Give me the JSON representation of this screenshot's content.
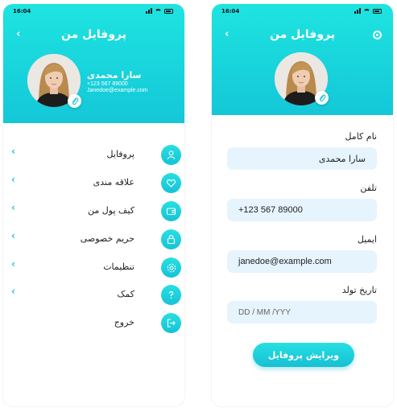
{
  "status_bar": {
    "time": "16:04"
  },
  "left_screen": {
    "title": "پروفایل من",
    "back_glyph": "‹",
    "user": {
      "name": "سارا محمدی",
      "phone": "+123 567 89000",
      "email": "Janedoe@example.com"
    },
    "menu": [
      {
        "label": "پروفایل",
        "icon": "user-icon"
      },
      {
        "label": "علاقه مندی",
        "icon": "heart-icon"
      },
      {
        "label": "کیف پول من",
        "icon": "wallet-icon"
      },
      {
        "label": "حریم خصوصی",
        "icon": "lock-icon"
      },
      {
        "label": "تنظیمات",
        "icon": "gear-icon"
      },
      {
        "label": "کمک",
        "icon": "help-icon"
      },
      {
        "label": "خروج",
        "icon": "logout-icon"
      }
    ]
  },
  "right_screen": {
    "title": "پروفایل من",
    "back_glyph": "‹",
    "fields": {
      "full_name": {
        "label": "نام کامل",
        "value": "سارا محمدی"
      },
      "phone": {
        "label": "تلفن",
        "value": "+123 567 89000"
      },
      "email": {
        "label": "ایمیل",
        "value": "janedoe@example.com"
      },
      "birthdate": {
        "label": "تاریخ تولد",
        "placeholder": "DD / MM /YYY"
      }
    },
    "edit_button": "ویرایش پروفایل"
  },
  "colors": {
    "accent": "#18c6d8",
    "accent_light": "#1ee4e0",
    "input_bg": "#e6f4fd"
  }
}
